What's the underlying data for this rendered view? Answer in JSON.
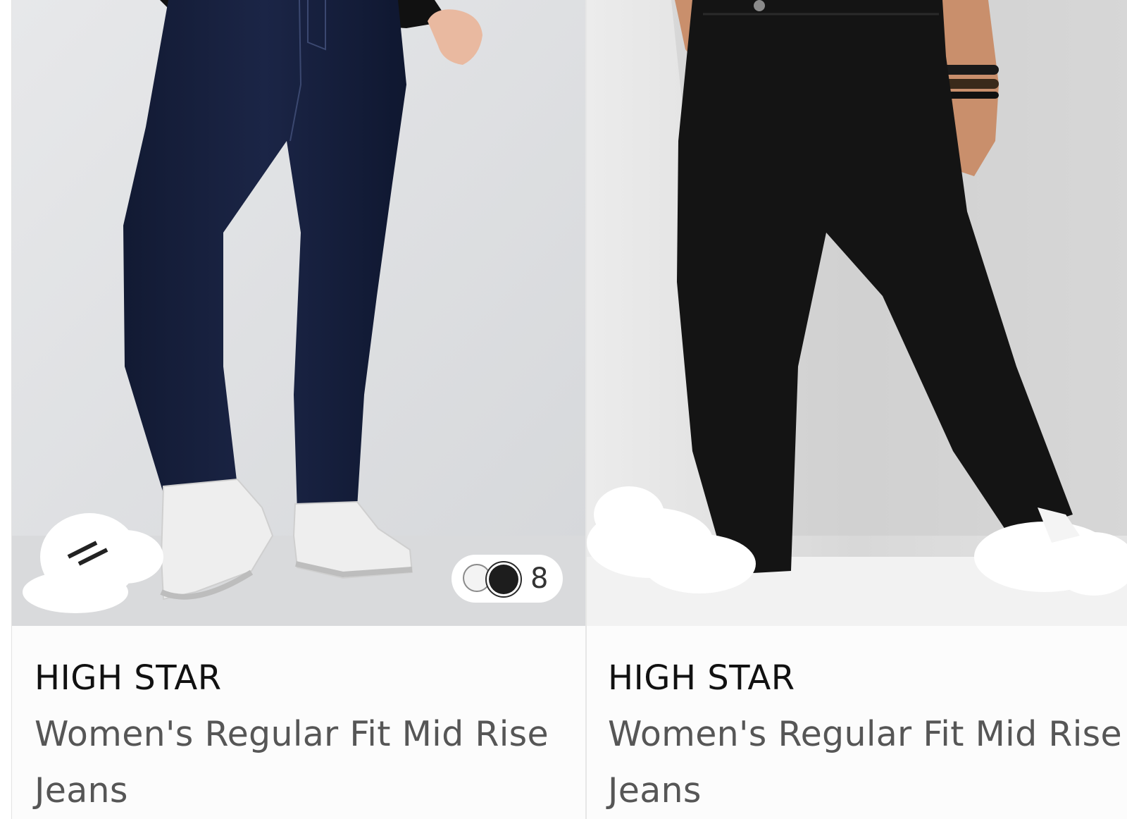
{
  "products": [
    {
      "brand": "HIGH STAR",
      "title": "Women's Regular Fit Mid Rise Jeans",
      "image": "dark-indigo-jeans-white-sneakers",
      "swatches": {
        "colors": [
          "#f3f3f3",
          "#1d1d1d"
        ],
        "count": "8"
      }
    },
    {
      "brand": "HIGH STAR",
      "title": "Women's Regular Fit Mid Rise Jeans",
      "image": "black-wide-leg-jeans"
    }
  ]
}
